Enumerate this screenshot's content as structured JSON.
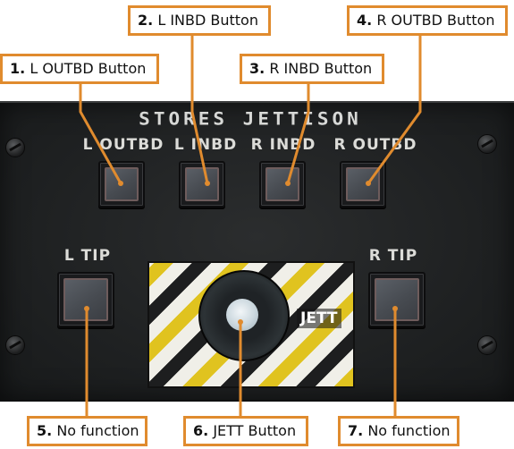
{
  "panel": {
    "title": "STORES JETTISON",
    "labels": {
      "l_outbd": "L OUTBD",
      "l_inbd": "L INBD",
      "r_inbd": "R INBD",
      "r_outbd": "R OUTBD",
      "l_tip": "L TIP",
      "r_tip": "R TIP",
      "jett": "JETT"
    }
  },
  "callouts": [
    {
      "num": "1.",
      "text": "L OUTBD Button"
    },
    {
      "num": "2.",
      "text": "L INBD Button"
    },
    {
      "num": "3.",
      "text": "R INBD Button"
    },
    {
      "num": "4.",
      "text": "R OUTBD Button"
    },
    {
      "num": "5.",
      "text": "No function"
    },
    {
      "num": "6.",
      "text": "JETT Button"
    },
    {
      "num": "7.",
      "text": "No function"
    }
  ],
  "colors": {
    "callout_border": "#e08b2e",
    "hazard_yellow": "#e0c31f",
    "panel": "#1f2122"
  }
}
